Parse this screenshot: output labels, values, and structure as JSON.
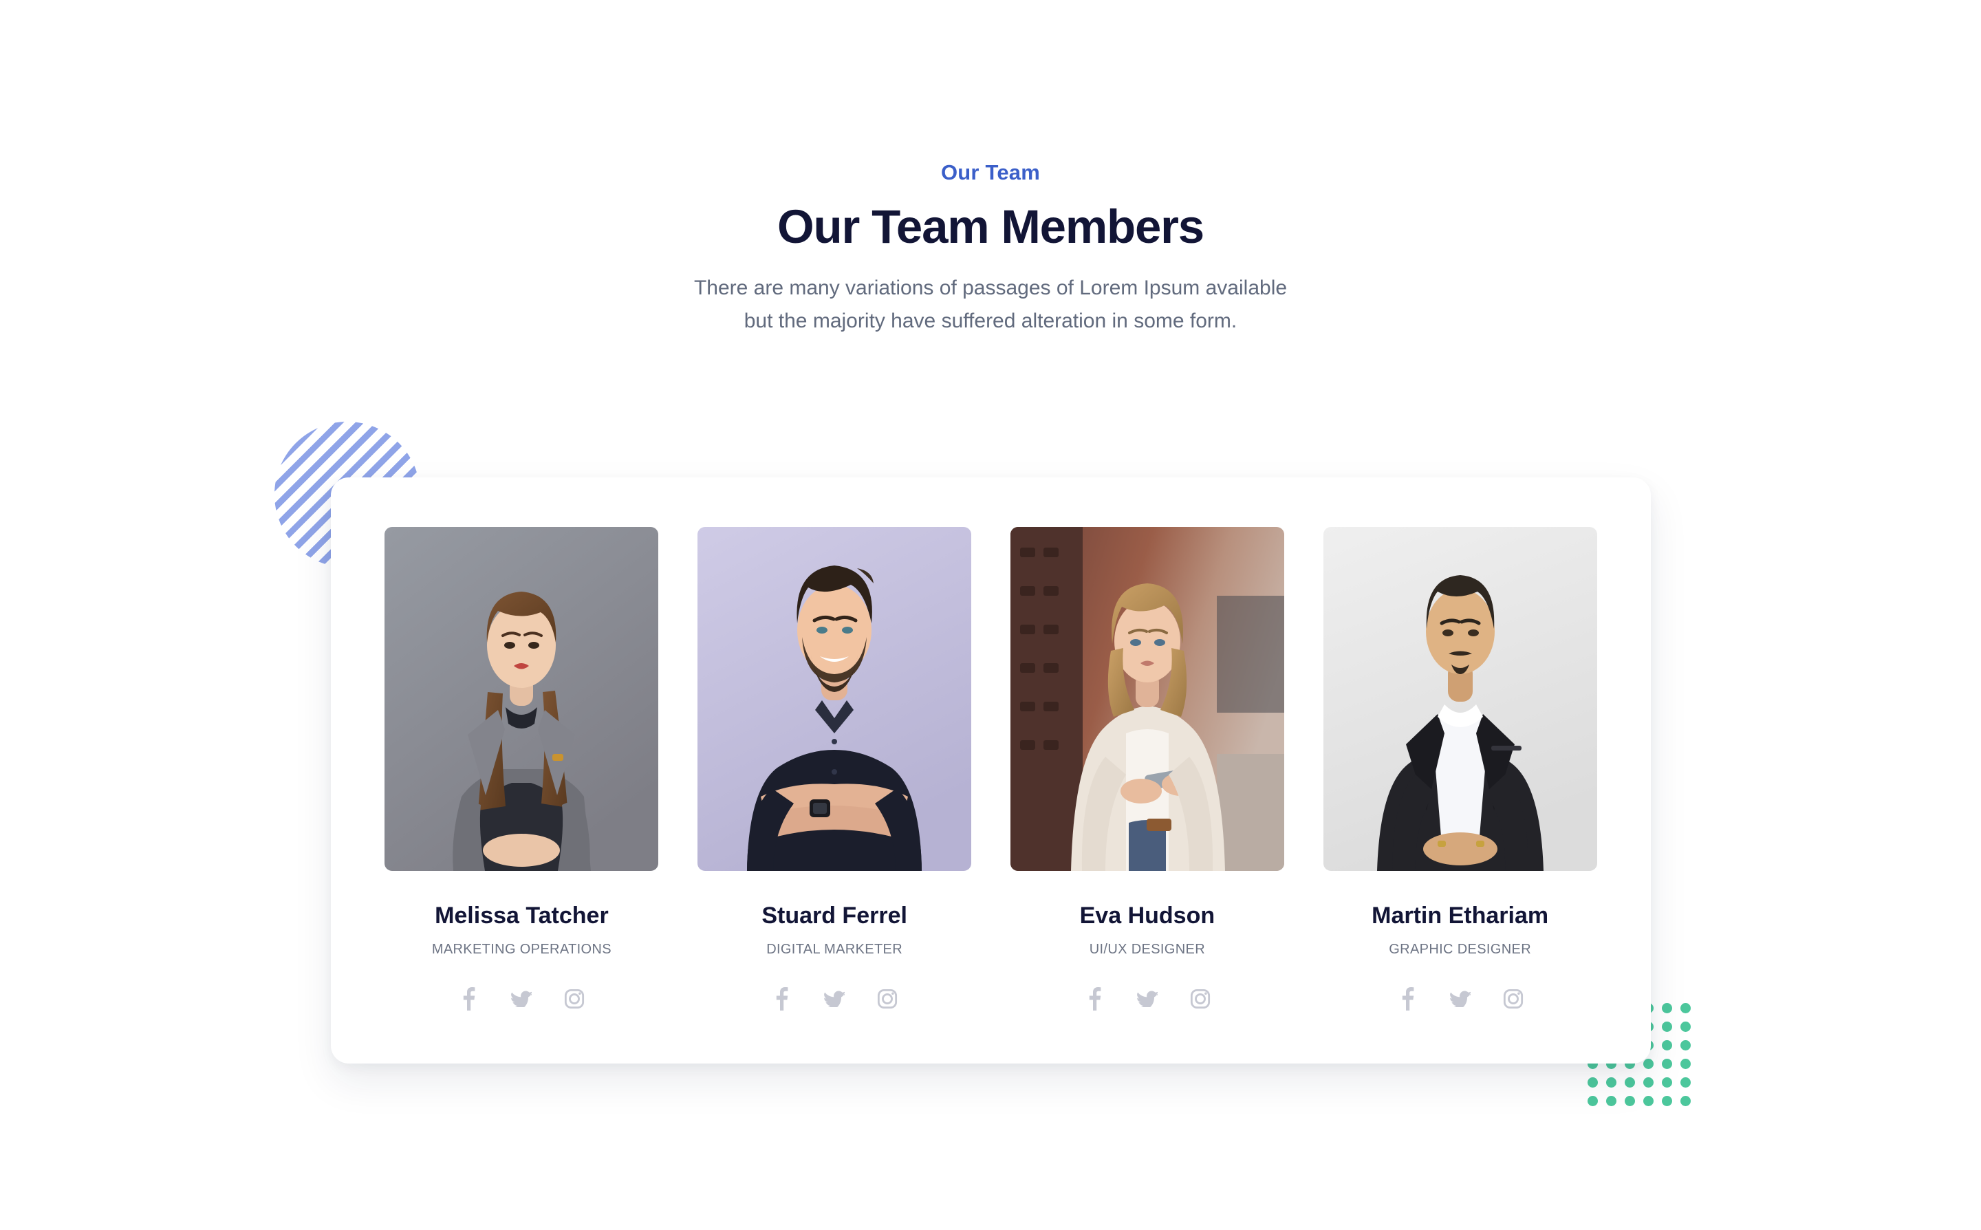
{
  "section": {
    "eyebrow": "Our Team",
    "title": "Our Team Members",
    "subtitle_line1": "There are many variations of passages of Lorem Ipsum available",
    "subtitle_line2": "but the majority have suffered alteration in some form."
  },
  "colors": {
    "accent_blue": "#3b5fc9",
    "heading_navy": "#121536",
    "body_gray": "#616a7d",
    "role_gray": "#6d7484",
    "social_icon_gray": "#c6c8d2",
    "decor_stripe_blue": "#8fa4e8",
    "decor_dot_green": "#4cc79c",
    "card_background": "#ffffff",
    "page_background": "#ffffff"
  },
  "decor": {
    "stripe_circle_name": "striped-circle-decoration",
    "dot_grid_name": "dotted-grid-decoration",
    "dot_grid_columns": 6,
    "dot_grid_rows": 6
  },
  "social_labels": {
    "facebook": "Facebook",
    "twitter": "Twitter",
    "instagram": "Instagram"
  },
  "members": [
    {
      "name": "Melissa Tatcher",
      "role": "MARKETING OPERATIONS",
      "photo_alt": "Portrait of a woman in a grey suit on a grey studio background",
      "photo_bg": "#8b8b93"
    },
    {
      "name": "Stuard Ferrel",
      "role": "DIGITAL MARKETER",
      "photo_alt": "Portrait of a bearded man with arms crossed on a lavender background",
      "photo_bg": "#c3bfdd"
    },
    {
      "name": "Eva Hudson",
      "role": "UI/UX DESIGNER",
      "photo_alt": "Woman holding a phone on a city street with brick buildings",
      "photo_bg": "#8d6253"
    },
    {
      "name": "Martin Ethariam",
      "role": "GRAPHIC DESIGNER",
      "photo_alt": "Man in a black suit and white shirt on a light grey background",
      "photo_bg": "#e4e4e4"
    }
  ]
}
